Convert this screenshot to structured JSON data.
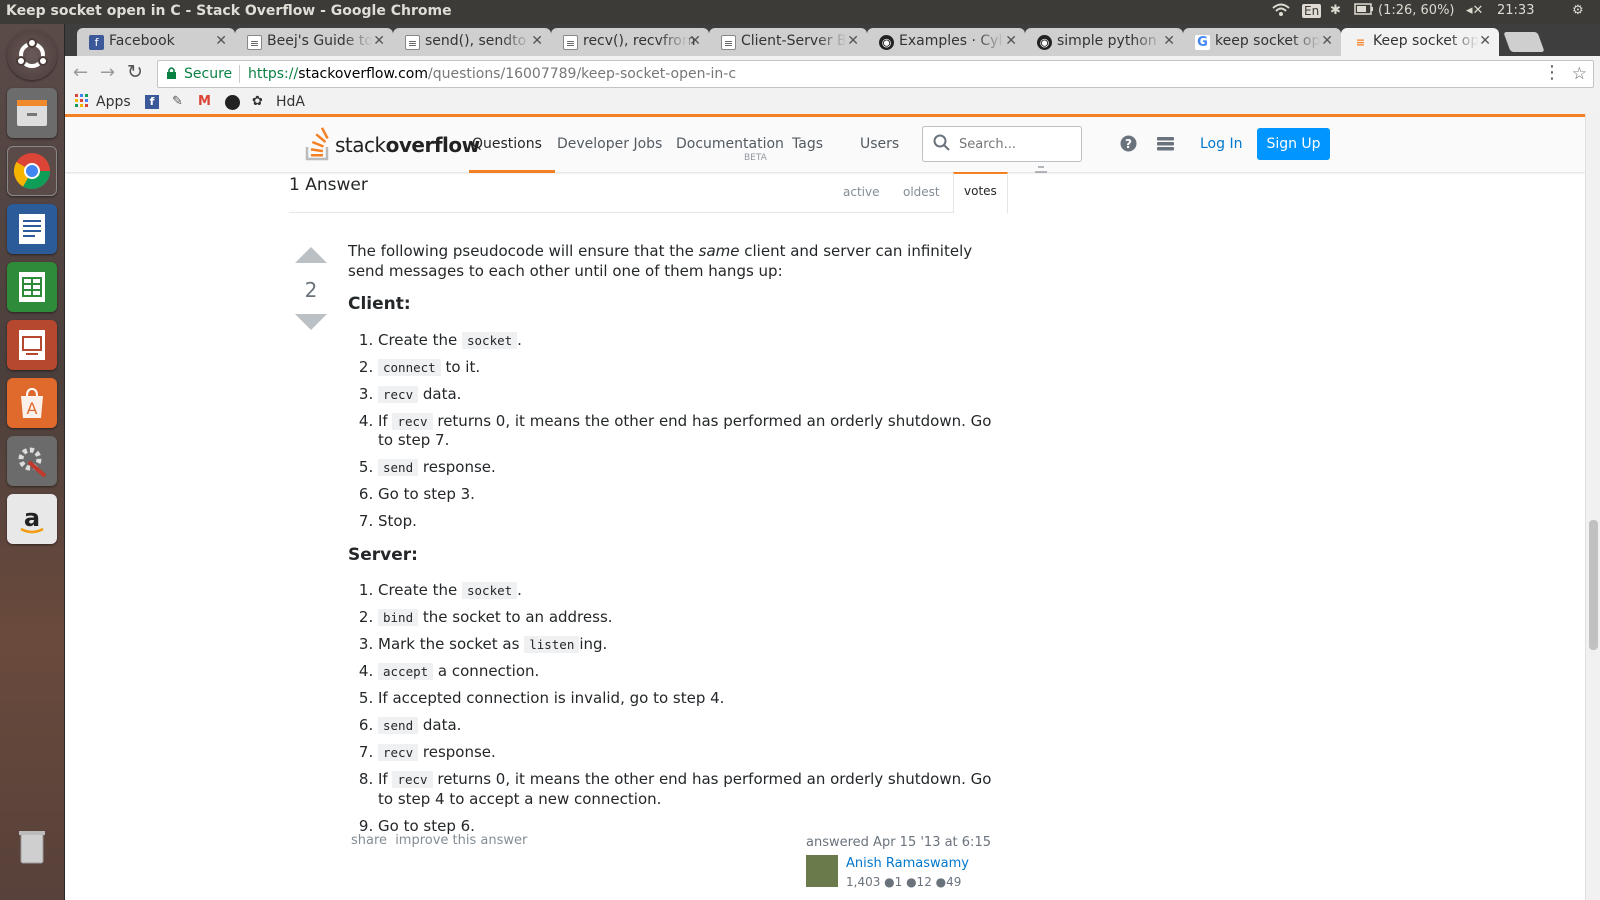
{
  "os": {
    "window_title": "Keep socket open in C - Stack Overflow - Google Chrome",
    "keyboard_layout": "En",
    "battery": "(1:26, 60%)",
    "clock": "21:33"
  },
  "browser": {
    "tabs": [
      {
        "label": "Facebook",
        "icon": "facebook-icon"
      },
      {
        "label": "Beej's Guide to",
        "icon": "page-icon"
      },
      {
        "label": "send(), sendto",
        "icon": "page-icon"
      },
      {
        "label": "recv(), recvfrom",
        "icon": "page-icon"
      },
      {
        "label": "Client-Server B",
        "icon": "page-icon"
      },
      {
        "label": "Examples · Cyl",
        "icon": "github-icon"
      },
      {
        "label": "simple python",
        "icon": "github-icon"
      },
      {
        "label": "keep socket op",
        "icon": "google-icon"
      },
      {
        "label": "Keep socket op",
        "icon": "stackoverflow-icon"
      }
    ],
    "security_label": "Secure",
    "url_scheme": "https://",
    "url_host": "stackoverflow.com",
    "url_path": "/questions/16007789/keep-socket-open-in-c",
    "bookmarks": {
      "apps_label": "Apps",
      "hda_label": "HdA"
    }
  },
  "site": {
    "logo_light": "stack",
    "logo_bold": "overflow",
    "nav": [
      {
        "label": "Questions"
      },
      {
        "label": "Developer Jobs"
      },
      {
        "label": "Documentation"
      },
      {
        "label": "Tags"
      },
      {
        "label": "Users"
      }
    ],
    "documentation_badge": "BETA",
    "search_placeholder": "Search...",
    "login_label": "Log In",
    "signup_label": "Sign Up"
  },
  "answers": {
    "count_label": "1 Answer",
    "sort_tabs": [
      "active",
      "oldest",
      "votes"
    ],
    "selected_sort": "votes"
  },
  "answer": {
    "score": "2",
    "intro_before": "The following pseudocode will ensure that the ",
    "intro_em": "same",
    "intro_after": " client and server can infinitely send messages to each other until one of them hangs up:",
    "client_heading": "Client:",
    "client_steps": [
      {
        "before": "Create the ",
        "code": "socket",
        "after": "."
      },
      {
        "before": "",
        "code": "connect",
        "after": " to it."
      },
      {
        "before": "",
        "code": "recv",
        "after": " data."
      },
      {
        "before": "If ",
        "code": "recv",
        "after": " returns 0, it means the other end has performed an orderly shutdown. Go to step 7."
      },
      {
        "before": "",
        "code": "send",
        "after": " response."
      },
      {
        "before": "Go to step 3.",
        "code": "",
        "after": ""
      },
      {
        "before": "Stop.",
        "code": "",
        "after": ""
      }
    ],
    "server_heading": "Server:",
    "server_steps": [
      {
        "before": "Create the ",
        "code": "socket",
        "after": "."
      },
      {
        "before": "",
        "code": "bind",
        "after": " the socket to an address."
      },
      {
        "before": "Mark the socket as ",
        "code": "listen",
        "after": "ing."
      },
      {
        "before": "",
        "code": "accept",
        "after": " a connection."
      },
      {
        "before": "If accepted connection is invalid, go to step 4.",
        "code": "",
        "after": ""
      },
      {
        "before": "",
        "code": "send",
        "after": " data."
      },
      {
        "before": "",
        "code": "recv",
        "after": " response."
      },
      {
        "before": "If ",
        "code": "recv",
        "after": " returns 0, it means the other end has performed an orderly shutdown. Go to step 4 to accept a new connection."
      },
      {
        "before": "Go to step 6.",
        "code": "",
        "after": ""
      }
    ],
    "share_label": "share",
    "improve_label": "improve this answer",
    "answered_label": "answered Apr 15 '13 at 6:15",
    "author": "Anish Ramaswamy",
    "author_rep": "1,403 ●1 ●12 ●49"
  },
  "colors": {
    "accent": "#f48024",
    "link": "#0077cc",
    "signup_bg": "#0095ff"
  }
}
